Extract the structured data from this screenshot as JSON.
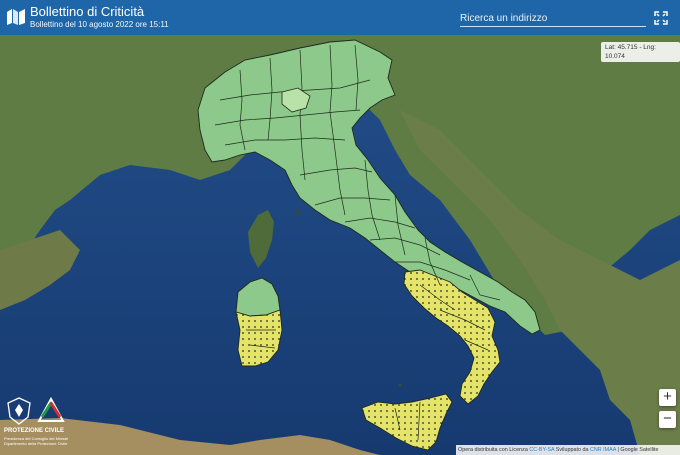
{
  "header": {
    "title": "Bollettino di Criticità",
    "subtitle": "Bollettino del 10 agosto 2022 ore 15:11",
    "search_placeholder": "Ricerca un indirizzo"
  },
  "map": {
    "coords_text": "Lat: 45.715 - Lng: 10.074",
    "zoom_in_label": "+",
    "zoom_out_label": "−",
    "legend_colors": {
      "green": "#8dc98a",
      "yellow": "#e5e46a",
      "sea": "#1d4e8e",
      "land": "#5d7a45"
    }
  },
  "attribution": {
    "prefix": "Opera distribuita con Licenza ",
    "license": "CC-BY-SA",
    "middle": " Sviluppato da ",
    "dev": "CNR IMAA",
    "suffix": " | Google Satellite"
  },
  "brand": {
    "name": "PROTEZIONE CIVILE",
    "line1": "Presidenza del Consiglio dei Ministri",
    "line2": "Dipartimento della Protezione Civile"
  },
  "icons": [
    "map-icon",
    "expand-icon",
    "emblem-icon",
    "protezione-civile-logo-icon"
  ]
}
